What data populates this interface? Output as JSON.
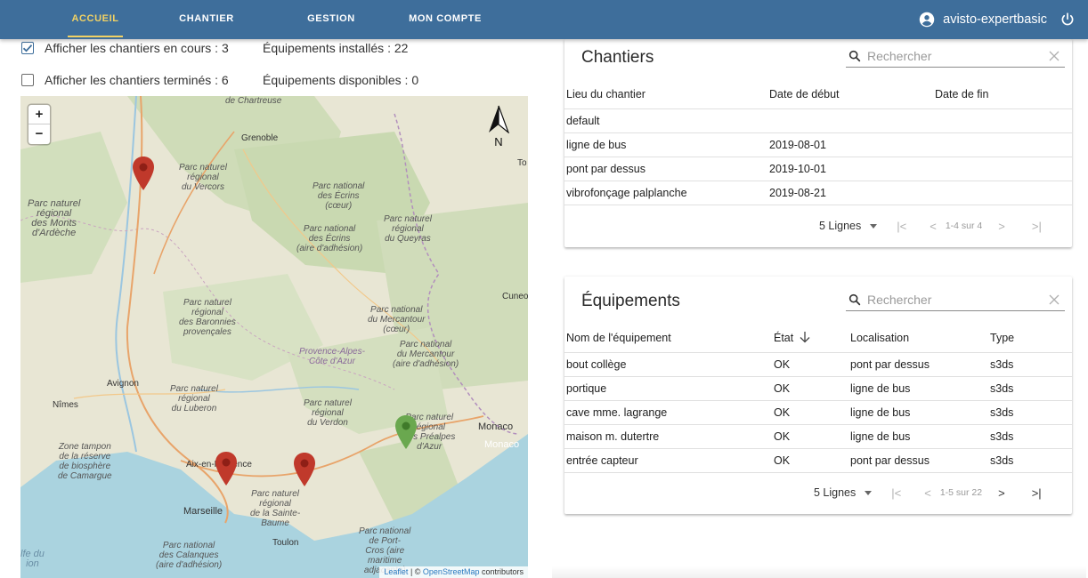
{
  "nav": {
    "tabs": [
      {
        "label": "ACCUEIL",
        "active": true
      },
      {
        "label": "CHANTIER",
        "active": false
      },
      {
        "label": "GESTION",
        "active": false
      },
      {
        "label": "MON COMPTE",
        "active": false
      }
    ],
    "username": "avisto-expertbasic",
    "icons": {
      "user": "account-circle-icon",
      "logout": "power-icon"
    },
    "colors": {
      "bar": "#3e6e9b",
      "active_tab": "#f2d264"
    }
  },
  "filters": {
    "show_active": {
      "label": "Afficher les chantiers en cours : 3",
      "checked": true
    },
    "show_finished": {
      "label": "Afficher les chantiers terminés : 6",
      "checked": false
    },
    "installed": "Équipements installés : 22",
    "available": "Équipements disponibles : 0"
  },
  "map": {
    "zoom_in": "+",
    "zoom_out": "−",
    "north": "N",
    "places": {
      "chartreuse": "de Chartreuse",
      "grenoble": "Grenoble",
      "vercors": "Parc naturel\nrégional\ndu Vercors",
      "monts_ardeche": "Parc naturel\nrégional\ndes Monts\nd'Ardèche",
      "ecrins_coeur": "Parc national\ndes Écrins\n(cœur)",
      "ecrins_adh": "Parc national\ndes Écrins\n(aire d'adhésion)",
      "queyras": "Parc naturel\nrégional\ndu Queyras",
      "baronnies": "Parc naturel\nrégional\ndes Baronnies\nprovençales",
      "mercantour_coeur": "Parc national\ndu Mercantour\n(cœur)",
      "mercantour_adh": "Parc national\ndu Mercantour\n(aire d'adhésion)",
      "paca": "Provence-Alpes-\nCôte d'Azur",
      "cuneo": "Cuneo",
      "avignon": "Avignon",
      "nimes": "Nîmes",
      "luberon": "Parc naturel\nrégional\ndu Luberon",
      "verdon": "Parc naturel\nrégional\ndu Verdon",
      "prealpes": "Parc naturel\nrégional\ndes Préalpes\nd'Azur",
      "monaco": "Monaco",
      "monaco2": "Monaco",
      "camargue": "Zone tampon\nde la réserve\nde biosphère\nde Camargue",
      "aix": "Aix-en-Provence",
      "marseille": "Marseille",
      "sainte_baume": "Parc naturel\nrégional\nde la Sainte-\nBaume",
      "toulon": "Toulon",
      "calanques": "Parc national\ndes Calanques\n(aire d'adhésion)",
      "port_cros": "Parc national\nde Port-\nCros (aire\nmaritime\nadjacente)",
      "golfe": "lfe du\nion",
      "to": "To"
    },
    "markers": [
      {
        "name": "marker-red-1",
        "color": "#c0392b"
      },
      {
        "name": "marker-red-2",
        "color": "#c0392b"
      },
      {
        "name": "marker-red-3",
        "color": "#c0392b"
      },
      {
        "name": "marker-green-1",
        "color": "#6aa84f"
      }
    ],
    "attribution": {
      "leaflet": "Leaflet",
      "sep": " | © ",
      "osm": "OpenStreetMap",
      "suffix": " contributors"
    }
  },
  "chantiers": {
    "title": "Chantiers",
    "search_placeholder": "Rechercher",
    "columns": [
      "Lieu du chantier",
      "Date de début",
      "Date de fin"
    ],
    "rows": [
      [
        "default",
        "",
        ""
      ],
      [
        "ligne de bus",
        "2019-08-01",
        ""
      ],
      [
        "pont par dessus",
        "2019-10-01",
        ""
      ],
      [
        "vibrofonçage palplanche",
        "2019-08-21",
        ""
      ]
    ],
    "pagination": {
      "rows_per_page": "5 Lignes",
      "range": "1-4 sur 4",
      "first": "|<",
      "prev": "<",
      "next": ">",
      "last": ">|"
    }
  },
  "equipements": {
    "title": "Équipements",
    "search_placeholder": "Rechercher",
    "columns": [
      "Nom de l'équipement",
      "État",
      "Localisation",
      "Type"
    ],
    "rows": [
      [
        "bout collège",
        "OK",
        "pont par dessus",
        "s3ds"
      ],
      [
        "portique",
        "OK",
        "ligne de bus",
        "s3ds"
      ],
      [
        "cave mme. lagrange",
        "OK",
        "ligne de bus",
        "s3ds"
      ],
      [
        "maison m. dutertre",
        "OK",
        "ligne de bus",
        "s3ds"
      ],
      [
        "entrée capteur",
        "OK",
        "pont par dessus",
        "s3ds"
      ]
    ],
    "pagination": {
      "rows_per_page": "5 Lignes",
      "range": "1-5 sur 22",
      "first": "|<",
      "prev": "<",
      "next": ">",
      "last": ">|"
    }
  }
}
